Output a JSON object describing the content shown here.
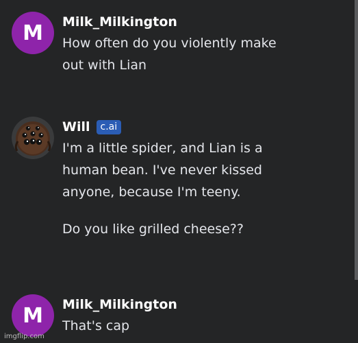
{
  "messages": [
    {
      "avatar_letter": "M",
      "author": "Milk_Milkington",
      "lines": [
        "How often do you violently make",
        "out with Lian"
      ]
    },
    {
      "avatar_icon": "spider-avatar-icon",
      "author": "Will",
      "badge": "c.ai",
      "paragraph1": [
        "I'm a little spider, and Lian is a",
        "human bean. I've never kissed",
        "anyone, because I'm teeny."
      ],
      "paragraph2": [
        "Do you like grilled cheese??"
      ]
    },
    {
      "avatar_letter": "M",
      "author": "Milk_Milkington",
      "lines": [
        "That's cap"
      ]
    }
  ],
  "watermark": "imgflip.com",
  "colors": {
    "background": "#242526",
    "avatar_purple": "#8e24aa",
    "badge_blue": "#2b5db5"
  }
}
